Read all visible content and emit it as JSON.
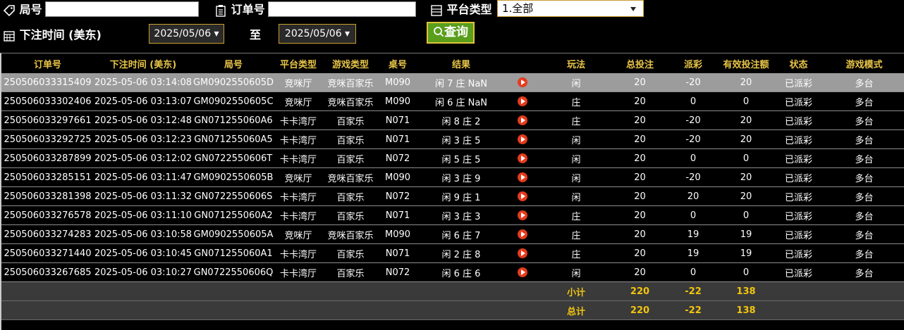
{
  "filters": {
    "round_label": "局号",
    "round_value": "",
    "order_label": "订单号",
    "order_value": "",
    "platform_label": "平台类型",
    "platform_selected": "1.全部",
    "bet_time_label": "下注时间 (美东)",
    "date_from": "2025/05/06 ▾",
    "to_label": "至",
    "date_to": "2025/05/06 ▾",
    "query_button": "查询"
  },
  "table": {
    "headers": [
      "订单号",
      "下注时间 (美东)",
      "局号",
      "平台类型",
      "游戏类型",
      "桌号",
      "结果",
      "",
      "玩法",
      "总投注",
      "派彩",
      "有效投注额",
      "状态",
      "游戏模式"
    ],
    "rows": [
      {
        "order": "250506033315409",
        "time": "2025-05-06 03:14:08",
        "round": "GM0902550605D",
        "platform": "竞咪厅",
        "game": "竞咪百家乐",
        "table": "M090",
        "result": "闲 7 庄 NaN",
        "play": "闲",
        "bet": "20",
        "payout": "-20",
        "payout_color": "green",
        "valid": "20",
        "status": "已派彩",
        "mode": "多台"
      },
      {
        "order": "250506033302406",
        "time": "2025-05-06 03:13:07",
        "round": "GM0902550605C",
        "platform": "竞咪厅",
        "game": "竞咪百家乐",
        "table": "M090",
        "result": "闲 6 庄 NaN",
        "play": "庄",
        "bet": "20",
        "payout": "0",
        "payout_color": "white",
        "valid": "0",
        "status": "已派彩",
        "mode": "多台"
      },
      {
        "order": "250506033297661",
        "time": "2025-05-06 03:12:48",
        "round": "GN071255060A6",
        "platform": "卡卡湾厅",
        "game": "百家乐",
        "table": "N071",
        "result": "闲 8 庄 2",
        "play": "庄",
        "bet": "20",
        "payout": "-20",
        "payout_color": "green",
        "valid": "20",
        "status": "已派彩",
        "mode": "多台"
      },
      {
        "order": "250506033292725",
        "time": "2025-05-06 03:12:23",
        "round": "GN071255060A5",
        "platform": "卡卡湾厅",
        "game": "百家乐",
        "table": "N071",
        "result": "闲 3 庄 5",
        "play": "闲",
        "bet": "20",
        "payout": "-20",
        "payout_color": "green",
        "valid": "20",
        "status": "已派彩",
        "mode": "多台"
      },
      {
        "order": "250506033287899",
        "time": "2025-05-06 03:12:02",
        "round": "GN0722550606T",
        "platform": "卡卡湾厅",
        "game": "百家乐",
        "table": "N072",
        "result": "闲 5 庄 5",
        "play": "闲",
        "bet": "20",
        "payout": "0",
        "payout_color": "white",
        "valid": "0",
        "status": "已派彩",
        "mode": "多台"
      },
      {
        "order": "250506033285151",
        "time": "2025-05-06 03:11:47",
        "round": "GM0902550605B",
        "platform": "竞咪厅",
        "game": "竞咪百家乐",
        "table": "M090",
        "result": "闲 3 庄 9",
        "play": "闲",
        "bet": "20",
        "payout": "-20",
        "payout_color": "green",
        "valid": "20",
        "status": "已派彩",
        "mode": "多台"
      },
      {
        "order": "250506033281398",
        "time": "2025-05-06 03:11:32",
        "round": "GN0722550606S",
        "platform": "卡卡湾厅",
        "game": "百家乐",
        "table": "N072",
        "result": "闲 9 庄 1",
        "play": "闲",
        "bet": "20",
        "payout": "20",
        "payout_color": "red",
        "valid": "20",
        "status": "已派彩",
        "mode": "多台"
      },
      {
        "order": "250506033276578",
        "time": "2025-05-06 03:11:10",
        "round": "GN071255060A2",
        "platform": "卡卡湾厅",
        "game": "百家乐",
        "table": "N071",
        "result": "闲 3 庄 3",
        "play": "庄",
        "bet": "20",
        "payout": "0",
        "payout_color": "white",
        "valid": "0",
        "status": "已派彩",
        "mode": "多台"
      },
      {
        "order": "250506033274283",
        "time": "2025-05-06 03:10:58",
        "round": "GM0902550605A",
        "platform": "竞咪厅",
        "game": "竞咪百家乐",
        "table": "M090",
        "result": "闲 6 庄 7",
        "play": "庄",
        "bet": "20",
        "payout": "19",
        "payout_color": "red",
        "valid": "19",
        "status": "已派彩",
        "mode": "多台"
      },
      {
        "order": "250506033271440",
        "time": "2025-05-06 03:10:45",
        "round": "GN071255060A1",
        "platform": "卡卡湾厅",
        "game": "百家乐",
        "table": "N071",
        "result": "闲 2 庄 8",
        "play": "庄",
        "bet": "20",
        "payout": "19",
        "payout_color": "red",
        "valid": "19",
        "status": "已派彩",
        "mode": "多台"
      },
      {
        "order": "250506033267685",
        "time": "2025-05-06 03:10:27",
        "round": "GN0722550606Q",
        "platform": "卡卡湾厅",
        "game": "百家乐",
        "table": "N072",
        "result": "闲 6 庄 6",
        "play": "闲",
        "bet": "20",
        "payout": "0",
        "payout_color": "white",
        "valid": "0",
        "status": "已派彩",
        "mode": "多台"
      }
    ],
    "subtotal": {
      "label": "小计",
      "bet": "220",
      "payout": "-22",
      "valid": "138"
    },
    "total": {
      "label": "总计",
      "bet": "220",
      "payout": "-22",
      "valid": "138"
    }
  },
  "colors": {
    "header_text": "#e8c547",
    "payout_green": "#5cff2a",
    "payout_red": "#c8102e",
    "status_green": "#3fe62c",
    "play_icon": "#e53a1d"
  }
}
